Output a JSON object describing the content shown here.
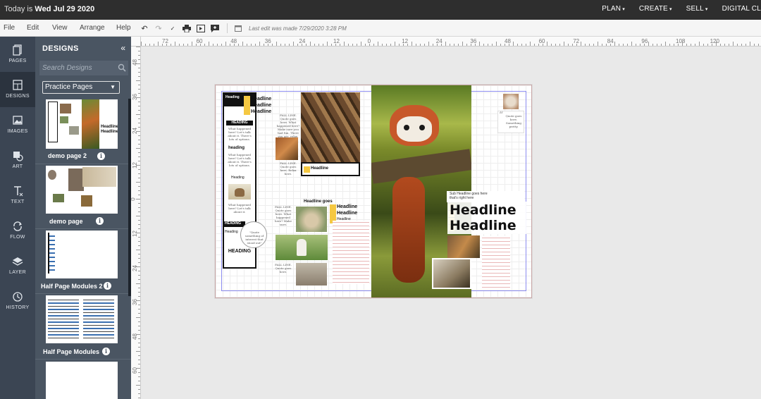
{
  "topbar": {
    "date_prefix": "Today is",
    "date_value": "Wed Jul 29 2020",
    "nav": [
      "PLAN",
      "CREATE",
      "SELL",
      "DIGITAL CL"
    ]
  },
  "menu": [
    "File",
    "Edit",
    "View",
    "Arrange",
    "Help"
  ],
  "toolbar": {
    "last_edit": "Last edit was made 7/29/2020 3:28 PM"
  },
  "rail": [
    {
      "label": "PAGES",
      "icon": "pages-icon"
    },
    {
      "label": "DESIGNS",
      "icon": "designs-icon"
    },
    {
      "label": "IMAGES",
      "icon": "images-icon"
    },
    {
      "label": "ART",
      "icon": "art-icon"
    },
    {
      "label": "TEXT",
      "icon": "text-icon"
    },
    {
      "label": "FLOW",
      "icon": "flow-icon"
    },
    {
      "label": "LAYER",
      "icon": "layer-icon"
    },
    {
      "label": "HISTORY",
      "icon": "history-icon"
    }
  ],
  "panel": {
    "title": "DESIGNS",
    "search_placeholder": "Search Designs",
    "selected_category": "Practice Pages",
    "designs": [
      "demo page 2",
      "demo page",
      "Half Page Modules 2",
      "Half Page Modules"
    ]
  },
  "ruler": {
    "h": [
      "72",
      "60",
      "48",
      "36",
      "24",
      "12",
      "0",
      "12",
      "24",
      "36",
      "48",
      "60",
      "72",
      "84",
      "96",
      "108",
      "120"
    ],
    "v": [
      "48",
      "36",
      "24",
      "12",
      "0",
      "12",
      "24",
      "36",
      "48",
      "60"
    ]
  },
  "canvas": {
    "left_headlines": [
      "Headline",
      "Headline",
      "Headline"
    ],
    "sidebar_heading": "Heading",
    "sidebar_tag1": "HEADING",
    "sidebar_sub": "heading",
    "sidebar_heading2": "Heading",
    "sidebar_tag2": "HEADING",
    "sidebar_heading3": "Heading",
    "sidebar_tag3": "HEADING",
    "photo_caption_headline": "Headline",
    "center_headline_top": "Headline goes",
    "center_headlines": [
      "Headline",
      "Headline",
      "Headline"
    ],
    "right_subhead": "Sub Headline goes here that's right here",
    "right_headline_1": "Headline",
    "right_headline_2": "Headline"
  },
  "colors": {
    "topbar": "#2e2e2e",
    "rail": "#3b4553",
    "panel": "#4a5562",
    "accent_yellow": "#f5c842"
  }
}
